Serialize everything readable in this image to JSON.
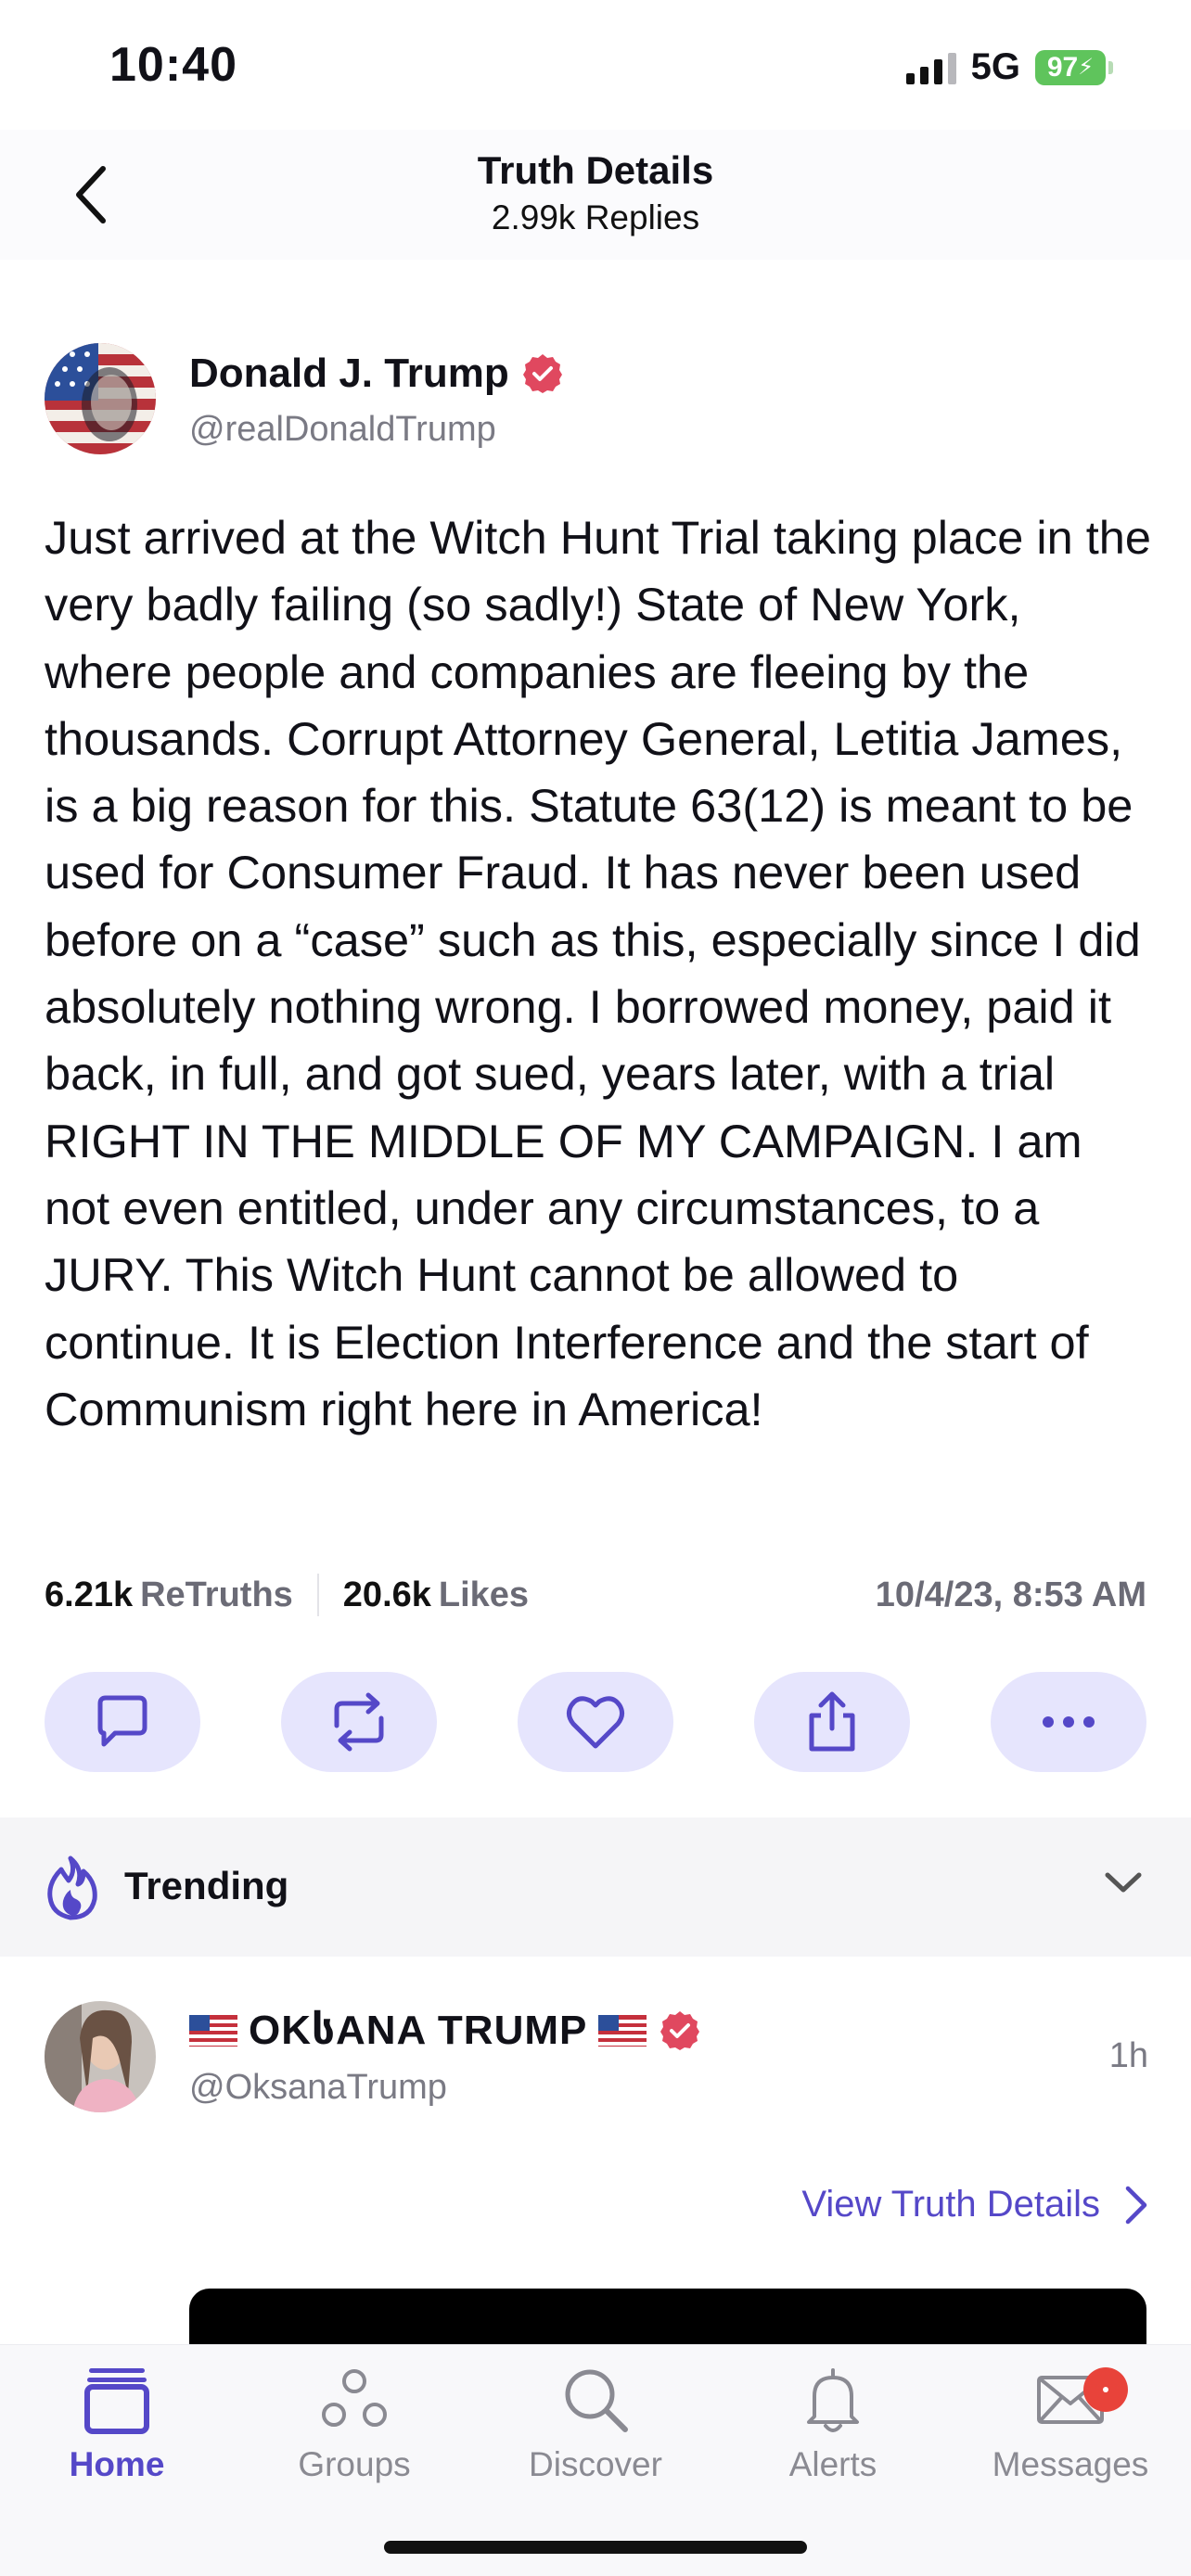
{
  "status_bar": {
    "time": "10:40",
    "network": "5G",
    "battery": "97"
  },
  "header": {
    "title": "Truth Details",
    "subtitle": "2.99k Replies"
  },
  "post": {
    "author_name": "Donald J. Trump",
    "author_handle": "@realDonaldTrump",
    "verified": true,
    "body": "Just arrived at the Witch Hunt Trial taking place in the very badly failing (so sadly!) State of New York, where people and companies are fleeing by the thousands. Corrupt Attorney General, Letitia James, is a big reason for this. Statute 63(12) is meant to be used for Consumer Fraud. It has never been used before on a “case” such as this, especially since I did absolutely nothing wrong. I borrowed money, paid it back, in full, and got sued, years later, with a trial RIGHT IN THE MIDDLE OF MY CAMPAIGN. I am not even entitled, under any circumstances, to a JURY. This Witch Hunt cannot be allowed to continue. It is Election Interference and the start of Communism right here in America!",
    "retruths_count": "6.21k",
    "retruths_label": "ReTruths",
    "likes_count": "20.6k",
    "likes_label": "Likes",
    "date": "10/4/23, 8:53 AM"
  },
  "actions": [
    "reply-icon",
    "retruth-icon",
    "like-icon",
    "share-icon",
    "more-icon"
  ],
  "trending": {
    "label": "Trending"
  },
  "trending_post": {
    "author_name": "OKსANA TRUMP",
    "author_handle": "@OksanaTrump",
    "time": "1h",
    "view_details": "View Truth Details"
  },
  "nav": {
    "home": "Home",
    "groups": "Groups",
    "discover": "Discover",
    "alerts": "Alerts",
    "messages": "Messages"
  },
  "colors": {
    "accent": "#5548c8",
    "action_bg": "#e6e5fd",
    "verified": "#e0485f",
    "badge": "#e8433a",
    "battery": "#5fc45c"
  }
}
